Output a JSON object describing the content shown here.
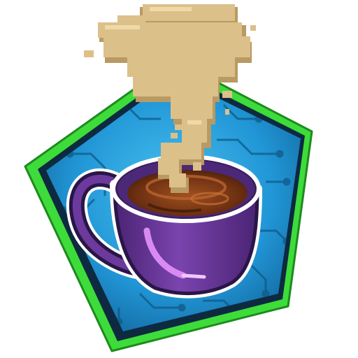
{
  "icon": {
    "name": "coffee-cup-badge-icon",
    "colors": {
      "frame_green": "#3ddc3a",
      "frame_dark": "#0d2a40",
      "panel_blue": "#1d8fd0",
      "panel_blue_light": "#3bb4ea",
      "circuit": "#0f5a86",
      "cup_purple": "#6b3a9c",
      "cup_purple_dark": "#3a1f5c",
      "cup_highlight": "#d98af2",
      "coffee_dark": "#5a2810",
      "coffee_mid": "#8a3d14",
      "steam": "#dcc08a",
      "steam_shadow": "#b89a62"
    }
  }
}
